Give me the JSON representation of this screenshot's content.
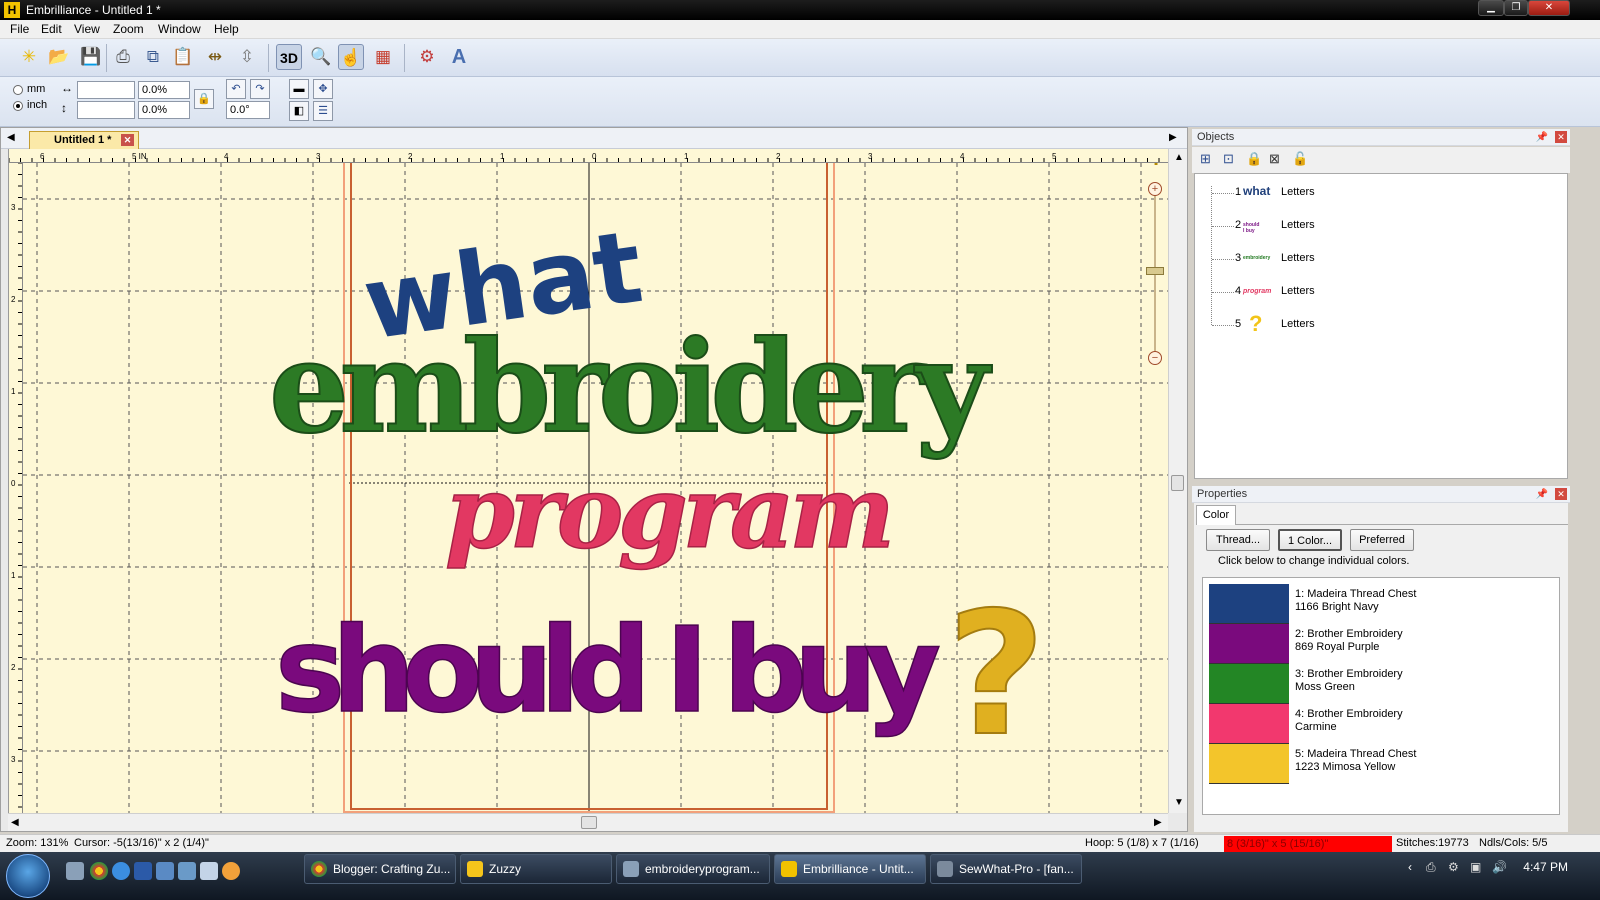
{
  "window": {
    "title": "Embrilliance -  Untitled 1 *",
    "app_icon": "H"
  },
  "menu": [
    "File",
    "Edit",
    "View",
    "Zoom",
    "Window",
    "Help"
  ],
  "toolbar": {
    "icons": [
      "new-icon",
      "open-icon",
      "save-icon",
      "print-icon",
      "copy-icon",
      "paste-icon",
      "mirror-h-icon",
      "mirror-v-icon",
      "3d-icon",
      "magnifier-icon",
      "pointer-icon",
      "stitch-player-icon",
      "settings-icon",
      "text-icon"
    ],
    "label_3d": "3D",
    "label_text": "A"
  },
  "toolbar2": {
    "unit_mm": "mm",
    "unit_inch": "inch",
    "width_value": "",
    "height_value": "",
    "width_pct": "0.0%",
    "height_pct": "0.0%",
    "rotation": "0.0°"
  },
  "document": {
    "tab_label": "Untitled 1 *",
    "ruler_h": [
      "6",
      "5 IN",
      "4",
      "3",
      "2",
      "1",
      "0",
      "1",
      "2",
      "3",
      "4",
      "5"
    ],
    "ruler_v": [
      "3",
      "2",
      "1",
      "0",
      "1",
      "2",
      "3"
    ],
    "design_text": {
      "line1": "what",
      "line2": "embroidery",
      "line3": "program",
      "line4": "should I buy",
      "line5": "?"
    }
  },
  "objects": {
    "title": "Objects",
    "items": [
      {
        "num": "1",
        "thumb": "what",
        "label": "Letters",
        "color": "#1f3f7a"
      },
      {
        "num": "2",
        "thumb": "should I buy",
        "label": "Letters",
        "color": "#7b1685"
      },
      {
        "num": "3",
        "thumb": "embroidery",
        "label": "Letters",
        "color": "#237a22"
      },
      {
        "num": "4",
        "thumb": "program",
        "label": "Letters",
        "color": "#e23862"
      },
      {
        "num": "5",
        "thumb": "?",
        "label": "Letters",
        "color": "#f2c418"
      }
    ]
  },
  "properties": {
    "title": "Properties",
    "tab": "Color",
    "buttons": [
      "Thread...",
      "1 Color...",
      "Preferred"
    ],
    "hint": "Click below to change individual colors.",
    "colors": [
      {
        "line1": "1: Madeira Thread Chest",
        "line2": "1166 Bright Navy",
        "hex": "#1d4180"
      },
      {
        "line1": "2: Brother Embroidery",
        "line2": "869 Royal Purple",
        "hex": "#7a0a7d"
      },
      {
        "line1": "3: Brother Embroidery",
        "line2": "Moss Green",
        "hex": "#238625"
      },
      {
        "line1": "4: Brother Embroidery",
        "line2": "Carmine",
        "hex": "#f2386e"
      },
      {
        "line1": "5: Madeira Thread Chest",
        "line2": "1223 Mimosa Yellow",
        "hex": "#f3c52b"
      }
    ]
  },
  "status": {
    "zoom": "Zoom: 131%",
    "cursor": "Cursor: -5(13/16)\" x 2 (1/4)\"",
    "hoop": "Hoop: 5 (1/8) x 7 (1/16)",
    "size": "8 (3/16)\" x 5 (15/16)\"",
    "stitches": "Stitches:19773",
    "ndls": "Ndls/Cols: 5/5"
  },
  "taskbar": {
    "tasks": [
      "Blogger: Crafting Zu...",
      "Zuzzy",
      "embroideryprogram...",
      "Embrilliance -  Untit...",
      "SewWhat-Pro - [fan..."
    ],
    "clock": "4:47 PM"
  }
}
